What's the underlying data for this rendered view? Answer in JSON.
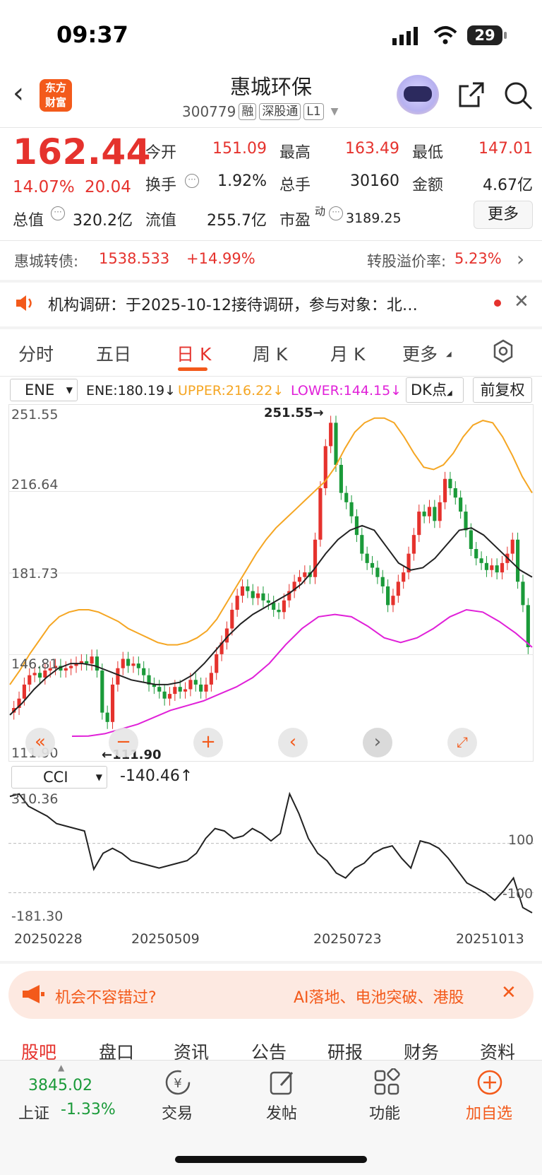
{
  "status_bar": {
    "time": "09:37",
    "battery": "29"
  },
  "header": {
    "logo_line1": "东方",
    "logo_line2": "财富",
    "stock_name": "惠城环保",
    "stock_code": "300779",
    "tags": [
      "融",
      "深股通",
      "L1"
    ]
  },
  "quote": {
    "price": "162.44",
    "change_pct": "14.07%",
    "change_amt": "20.04",
    "open_label": "今开",
    "open": "151.09",
    "high_label": "最高",
    "high": "163.49",
    "low_label": "最低",
    "low": "147.01",
    "turnover_label": "换手",
    "turnover": "1.92%",
    "volume_label": "总手",
    "volume": "30160",
    "amount_label": "金额",
    "amount": "4.67亿",
    "total_value_label": "总值",
    "total_value": "320.2亿",
    "float_value_label": "流值",
    "float_value": "255.7亿",
    "pe_label": "市盈",
    "pe_sup": "动",
    "pe": "3189.25",
    "more_label": "更多"
  },
  "bond": {
    "label": "惠城转债:",
    "price": "1538.533",
    "change": "+14.99%",
    "premium_label": "转股溢价率:",
    "premium": "5.23%"
  },
  "notice": {
    "text": "机构调研：于2025-10-12接待调研，参与对象：北…"
  },
  "chart_tabs": [
    "分时",
    "五日",
    "日 K",
    "周 K",
    "月 K",
    "更多"
  ],
  "active_chart_tab": "日 K",
  "indicator": {
    "name": "ENE",
    "ene": "ENE:180.19",
    "upper": "UPPER:216.22",
    "lower": "LOWER:144.15",
    "dk_label": "DK点",
    "adjust_label": "前复权"
  },
  "colors": {
    "up": "#e5322d",
    "down": "#1a9a39",
    "upper": "#f5a623",
    "lower": "#e020d8",
    "accent": "#f35a1b"
  },
  "chart_data": {
    "type": "candlestick",
    "y_axis_labels": [
      "251.55",
      "216.64",
      "181.73",
      "146.81",
      "111.90"
    ],
    "ylim": [
      111.9,
      251.55
    ],
    "max_marker": "251.55",
    "min_marker": "111.90",
    "dates": [
      "20250228",
      "20250509",
      "20250723",
      "20251013"
    ],
    "close": [
      124,
      128,
      134,
      138,
      139,
      137,
      140,
      141,
      142,
      140,
      141,
      142,
      143,
      144,
      143,
      146,
      140,
      122,
      118,
      134,
      141,
      145,
      142,
      143,
      141,
      138,
      134,
      133,
      131,
      128,
      130,
      133,
      131,
      132,
      136,
      134,
      131,
      134,
      139,
      147,
      152,
      158,
      166,
      172,
      176,
      174,
      171,
      173,
      170,
      169,
      166,
      165,
      170,
      174,
      178,
      180,
      182,
      180,
      196,
      218,
      236,
      246,
      228,
      216,
      212,
      206,
      198,
      190,
      186,
      184,
      180,
      176,
      168,
      172,
      178,
      182,
      190,
      198,
      208,
      206,
      210,
      204,
      212,
      222,
      218,
      214,
      208,
      200,
      192,
      188,
      186,
      183,
      185,
      182,
      186,
      190,
      196,
      178,
      168,
      150
    ],
    "upper": [
      134,
      140,
      147,
      153,
      159,
      163,
      165,
      166,
      166,
      165,
      163,
      161,
      158,
      156,
      154,
      152,
      151,
      151,
      152,
      154,
      157,
      162,
      169,
      176,
      183,
      190,
      196,
      201,
      205,
      209,
      213,
      217,
      221,
      227,
      235,
      242,
      246,
      248,
      248,
      246,
      240,
      233,
      227,
      226,
      228,
      233,
      240,
      245,
      247,
      246,
      240,
      232,
      223,
      216
    ],
    "mid": [
      121,
      126,
      132,
      137,
      141,
      143,
      143,
      142,
      140,
      138,
      136,
      135,
      134,
      134,
      135,
      138,
      143,
      149,
      155,
      160,
      164,
      167,
      170,
      173,
      177,
      183,
      190,
      196,
      200,
      202,
      200,
      193,
      186,
      183,
      184,
      188,
      194,
      200,
      201,
      198,
      193,
      188,
      183,
      180
    ],
    "lower": [
      111,
      112,
      113,
      115,
      117,
      120,
      123,
      125,
      127,
      130,
      133,
      137,
      143,
      151,
      158,
      163,
      164,
      163,
      159,
      154,
      152,
      154,
      158,
      163,
      166,
      165,
      161,
      156,
      150
    ],
    "cci": {
      "name": "CCI",
      "value": "-140.46",
      "top_label": "310.36",
      "bottom_label": "-181.30",
      "level_hi": "100",
      "level_lo": "-100",
      "values": [
        290,
        300,
        250,
        230,
        210,
        180,
        170,
        160,
        150,
        -5,
        60,
        80,
        60,
        30,
        20,
        10,
        0,
        10,
        20,
        30,
        60,
        120,
        160,
        150,
        120,
        130,
        160,
        140,
        110,
        140,
        300,
        220,
        120,
        60,
        30,
        -20,
        -40,
        0,
        20,
        60,
        80,
        90,
        40,
        0,
        110,
        100,
        80,
        40,
        -10,
        -60,
        -80,
        -100,
        -130,
        -90,
        -40,
        -160,
        -181
      ]
    }
  },
  "promo": {
    "prefix": "机会不容错过?",
    "highlight": "AI落地、电池突破、港股"
  },
  "bottom_tabs": [
    "股吧",
    "盘口",
    "资讯",
    "公告",
    "研报",
    "财务",
    "资料"
  ],
  "active_bottom_tab": "股吧",
  "market": {
    "index_value": "3845.02",
    "index_name": "上证",
    "index_change": "-1.33%"
  },
  "toolbar": [
    "交易",
    "发帖",
    "功能",
    "加自选"
  ]
}
